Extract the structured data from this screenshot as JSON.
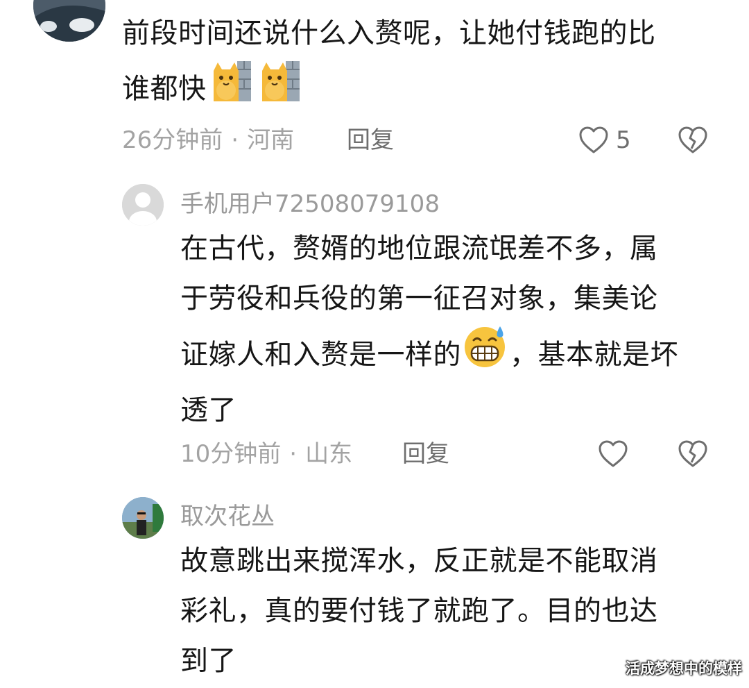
{
  "comments": [
    {
      "text_line1": "前段时间还说什么入赘呢，让她付钱跑的比",
      "text_line2": "谁都快",
      "time": "26分钟前",
      "separator": "·",
      "location": "河南",
      "reply_label": "回复",
      "like_count": "5",
      "emojis": [
        "cat-wall-emoji",
        "cat-wall-emoji"
      ]
    },
    {
      "username": "手机用户72508079108",
      "text_line1": "在古代，赘婿的地位跟流氓差不多，属",
      "text_line2": "于劳役和兵役的第一征召对象，集美论",
      "text_line3a": "证嫁人和入赘是一样的",
      "text_line3b": "，基本就是坏",
      "text_line4": "透了",
      "time": "10分钟前",
      "separator": "·",
      "location": "山东",
      "reply_label": "回复",
      "emojis": [
        "grimace-sweat-emoji"
      ]
    },
    {
      "username": "取次花丛",
      "text_line1": "故意跳出来搅浑水，反正就是不能取消",
      "text_line2": "彩礼，真的要付钱了就跑了。目的也达",
      "text_line3": "到了"
    }
  ],
  "watermark": "活成梦想中的模样",
  "colors": {
    "text": "#161616",
    "meta": "#a3a3a3",
    "icon": "#6e6e6e",
    "emoji_yellow": "#f5b93a"
  }
}
